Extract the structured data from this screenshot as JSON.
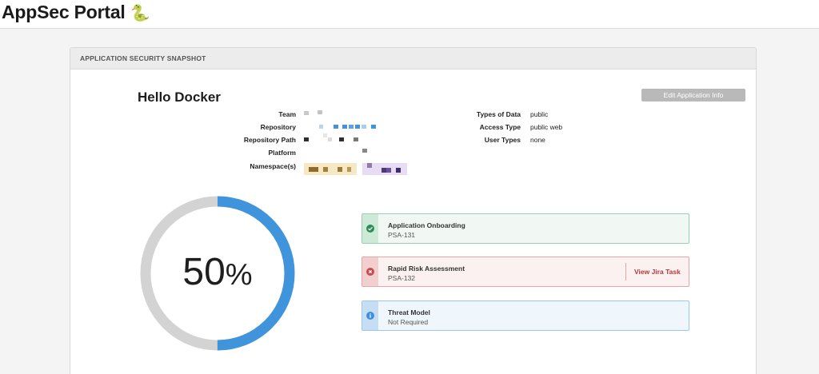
{
  "header": {
    "brand": "AppSec Portal",
    "brand_emoji": "🐍"
  },
  "card": {
    "title": "APPLICATION SECURITY SNAPSHOT",
    "app_name": "Hello Docker",
    "edit_label": "Edit Application Info",
    "meta_left": [
      {
        "label": "Team"
      },
      {
        "label": "Repository"
      },
      {
        "label": "Repository Path"
      },
      {
        "label": "Platform"
      },
      {
        "label": "Namespace(s)"
      }
    ],
    "meta_right": [
      {
        "label": "Types of Data",
        "value": "public"
      },
      {
        "label": "Access Type",
        "value": "public web"
      },
      {
        "label": "User Types",
        "value": "none"
      }
    ]
  },
  "progress": {
    "value": 50,
    "number": "50",
    "unit": "%"
  },
  "steps": [
    {
      "title": "Application Onboarding",
      "ticket": "PSA-131",
      "status": "complete",
      "icon": "check-circle-icon"
    },
    {
      "title": "Rapid Risk Assessment",
      "ticket": "PSA-132",
      "status": "incomplete",
      "icon": "x-circle-icon",
      "link_label": "View Jira Task"
    },
    {
      "title": "Threat Model",
      "ticket": "Not Required",
      "status": "info",
      "icon": "info-circle-icon"
    }
  ],
  "colors": {
    "accent": "#3f94dc",
    "track": "#d3d3d3",
    "ok": "#2e8b57",
    "fail": "#c94b4b",
    "info": "#3f8fdc"
  }
}
